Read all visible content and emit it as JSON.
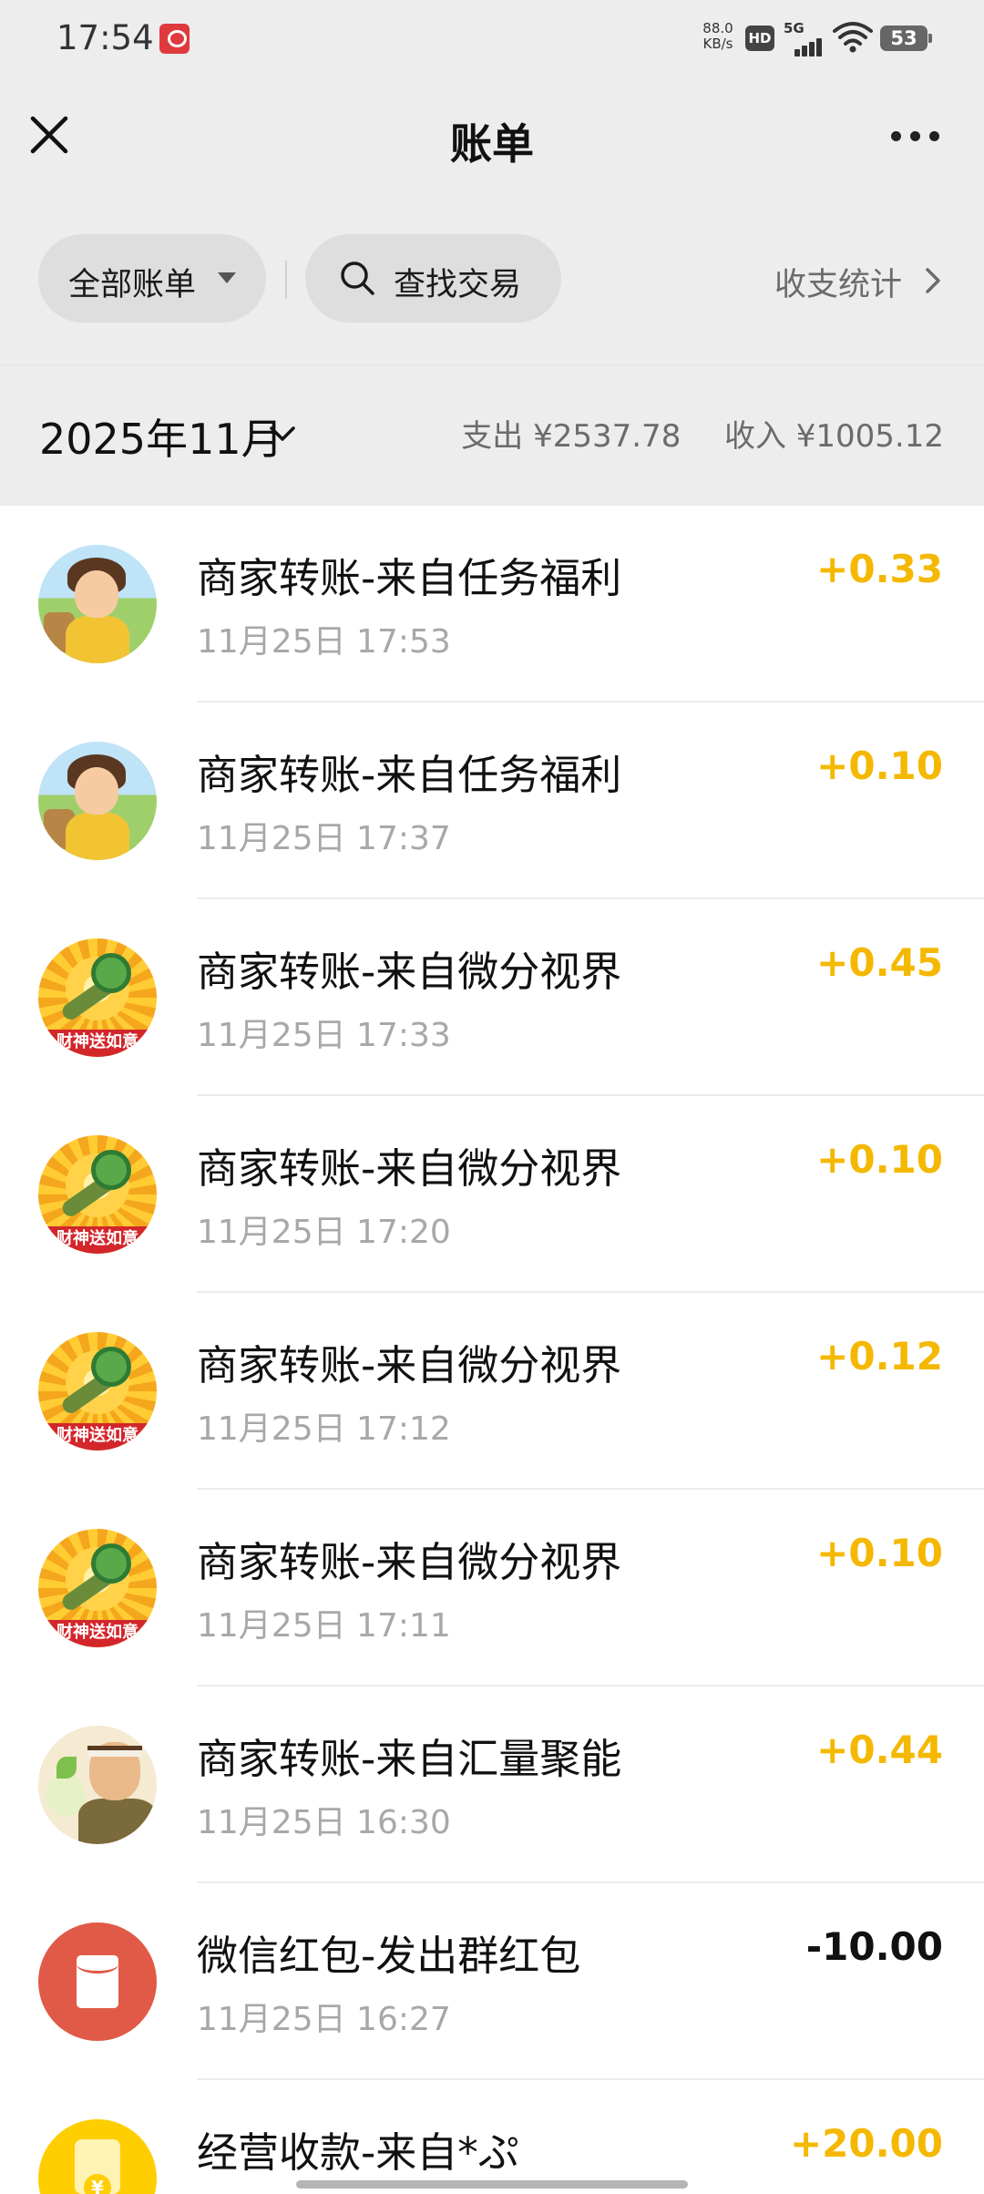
{
  "status_bar": {
    "time": "17:54",
    "net_speed_value": "88.0",
    "net_speed_unit": "KB/s",
    "hd_label": "HD",
    "network_label": "5G",
    "battery_level": "53"
  },
  "nav": {
    "title": "账单"
  },
  "filters": {
    "all_bills_label": "全部账单",
    "search_label": "查找交易",
    "stats_label": "收支统计"
  },
  "month": {
    "label": "2025年11月",
    "expense_label": "支出",
    "expense_value": "¥2537.78",
    "income_label": "收入",
    "income_value": "¥1005.12"
  },
  "transactions": [
    {
      "avatar": "girl-avatar",
      "title": "商家转账-来自任务福利",
      "time": "11月25日 17:53",
      "amount": "+0.33"
    },
    {
      "avatar": "girl-avatar",
      "title": "商家转账-来自任务福利",
      "time": "11月25日 17:37",
      "amount": "+0.10"
    },
    {
      "avatar": "ruyi-avatar",
      "title": "商家转账-来自微分视界",
      "time": "11月25日 17:33",
      "amount": "+0.45",
      "banner": "财神送如意"
    },
    {
      "avatar": "ruyi-avatar",
      "title": "商家转账-来自微分视界",
      "time": "11月25日 17:20",
      "amount": "+0.10",
      "banner": "财神送如意"
    },
    {
      "avatar": "ruyi-avatar",
      "title": "商家转账-来自微分视界",
      "time": "11月25日 17:12",
      "amount": "+0.12",
      "banner": "财神送如意"
    },
    {
      "avatar": "ruyi-avatar",
      "title": "商家转账-来自微分视界",
      "time": "11月25日 17:11",
      "amount": "+0.10",
      "banner": "财神送如意"
    },
    {
      "avatar": "farmer-avatar",
      "title": "商家转账-来自汇量聚能",
      "time": "11月25日 16:30",
      "amount": "+0.44"
    },
    {
      "avatar": "red-packet-icon",
      "title": "微信红包-发出群红包",
      "time": "11月25日 16:27",
      "amount": "-10.00"
    },
    {
      "avatar": "business-receipt-icon",
      "title": "经营收款-来自*ぷ",
      "time": "",
      "amount": "+20.00",
      "coin": "¥"
    }
  ],
  "colors": {
    "income_amount": "#f5b800",
    "expense_amount": "#111111",
    "background": "#ededed",
    "list_background": "#ffffff"
  }
}
